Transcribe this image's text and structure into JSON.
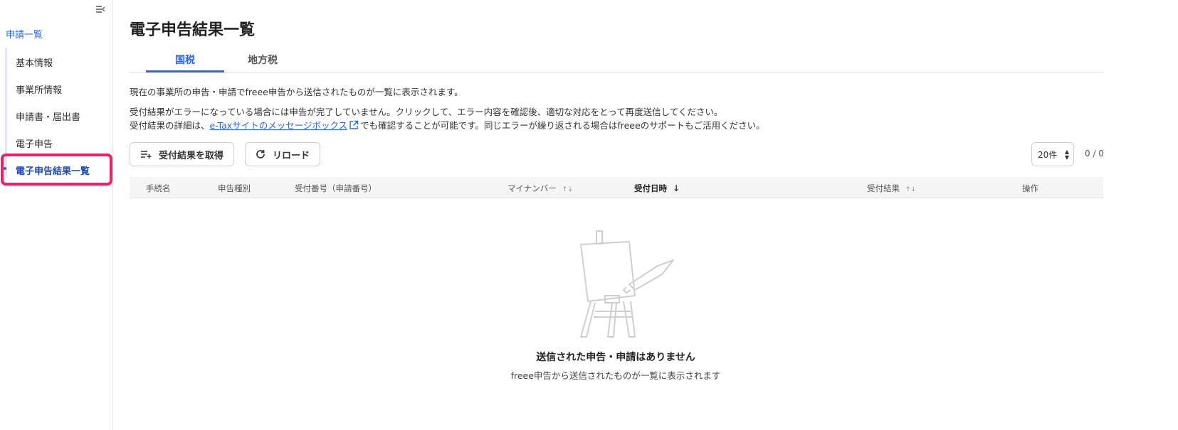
{
  "sidebar": {
    "section_label": "申請一覧",
    "items": [
      {
        "label": "基本情報"
      },
      {
        "label": "事業所情報"
      },
      {
        "label": "申請書・届出書"
      },
      {
        "label": "電子申告"
      },
      {
        "label": "電子申告結果一覧"
      }
    ],
    "active_index": 4
  },
  "page": {
    "title": "電子申告結果一覧",
    "tabs": [
      {
        "label": "国税",
        "active": true
      },
      {
        "label": "地方税",
        "active": false
      }
    ],
    "description": {
      "line1": "現在の事業所の申告・申請でfreee申告から送信されたものが一覧に表示されます。",
      "line2": "受付結果がエラーになっている場合には申告が完了していません。クリックして、エラー内容を確認後、適切な対応をとって再度送信してください。",
      "line3_prefix": "受付結果の詳細は、",
      "line3_link": "e-Taxサイトのメッセージボックス",
      "line3_suffix": "でも確認することが可能です。同じエラーが繰り返される場合はfreeeのサポートもご活用ください。"
    }
  },
  "toolbar": {
    "fetch_label": "受付結果を取得",
    "reload_label": "リロード",
    "per_page": "20件",
    "paging": "0 / 0"
  },
  "table": {
    "columns": [
      "手続名",
      "申告種別",
      "受付番号（申請番号）",
      "マイナンバー",
      "受付日時",
      "受付結果",
      "操作"
    ]
  },
  "empty_state": {
    "title": "送信された申告・申請はありません",
    "subtitle": "freee申告から送信されたものが一覧に表示されます"
  },
  "colors": {
    "accent": "#2864f0",
    "highlight_box": "#ee2266"
  },
  "icons": [
    "sidebar-collapse-icon",
    "external-link-icon",
    "list-add-icon",
    "reload-icon",
    "sort-icon",
    "sort-desc-icon",
    "easel-icon"
  ]
}
